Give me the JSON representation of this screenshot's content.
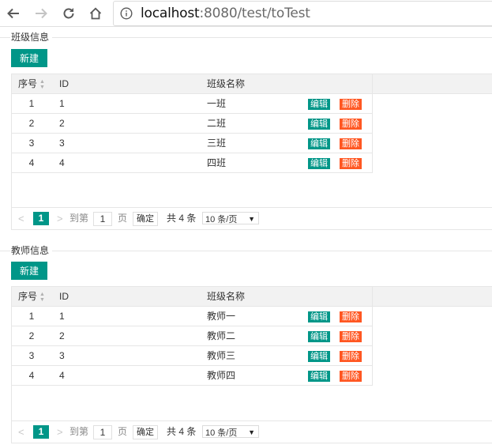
{
  "browser": {
    "url_host": "localhost",
    "url_rest": ":8080/test/toTest"
  },
  "sections": [
    {
      "title": "班级信息",
      "new_button": "新建",
      "columns": {
        "index": "序号",
        "id": "ID",
        "name": "班级名称"
      },
      "rows": [
        {
          "index": "1",
          "id": "1",
          "name": "一班"
        },
        {
          "index": "2",
          "id": "2",
          "name": "二班"
        },
        {
          "index": "3",
          "id": "3",
          "name": "三班"
        },
        {
          "index": "4",
          "id": "4",
          "name": "四班"
        }
      ],
      "edit_label": "编辑",
      "delete_label": "删除",
      "pager": {
        "current_page": "1",
        "goto_label": "到第",
        "page_input": "1",
        "page_label": "页",
        "confirm_label": "确定",
        "total_label": "共 4 条",
        "page_size": "10 条/页"
      }
    },
    {
      "title": "教师信息",
      "new_button": "新建",
      "columns": {
        "index": "序号",
        "id": "ID",
        "name": "班级名称"
      },
      "rows": [
        {
          "index": "1",
          "id": "1",
          "name": "教师一"
        },
        {
          "index": "2",
          "id": "2",
          "name": "教师二"
        },
        {
          "index": "3",
          "id": "3",
          "name": "教师三"
        },
        {
          "index": "4",
          "id": "4",
          "name": "教师四"
        }
      ],
      "edit_label": "编辑",
      "delete_label": "删除",
      "pager": {
        "current_page": "1",
        "goto_label": "到第",
        "page_input": "1",
        "page_label": "页",
        "confirm_label": "确定",
        "total_label": "共 4 条",
        "page_size": "10 条/页"
      }
    }
  ],
  "colors": {
    "primary": "#009688",
    "danger": "#FF5722"
  }
}
